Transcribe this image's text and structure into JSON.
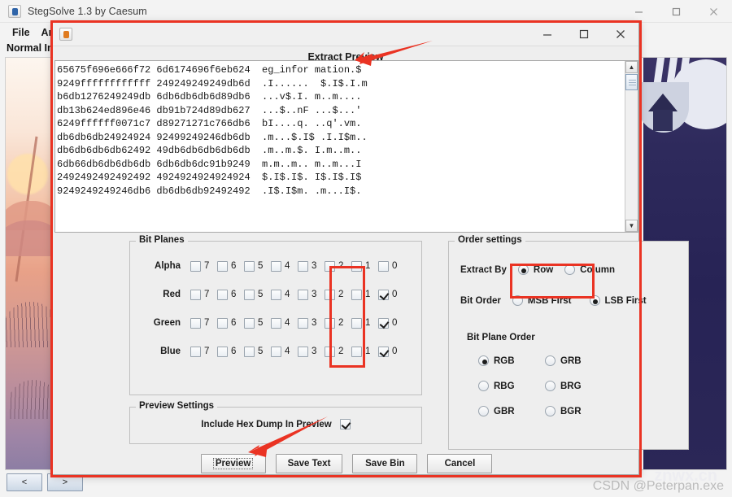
{
  "main_window": {
    "title": "StegSolve 1.3 by Caesum",
    "icon": "java-coffee-cup-icon",
    "menu": [
      "File",
      "Ana"
    ],
    "subtitle": "Normal Im",
    "window_buttons": [
      {
        "name": "minimize",
        "glyph": "─"
      },
      {
        "name": "maximize",
        "glyph": "□"
      },
      {
        "name": "close",
        "glyph": "✕"
      }
    ],
    "nav": [
      {
        "name": "prev",
        "label": "<"
      },
      {
        "name": "next",
        "label": ">"
      }
    ]
  },
  "watermark": {
    "csdn": "CSDN @Peterpan.exe",
    "site": "znwx.cn"
  },
  "dialog": {
    "icon": "java-coffee-cup-icon",
    "heading": "Extract Preview",
    "window_buttons": [
      {
        "name": "minimize",
        "glyph": "─"
      },
      {
        "name": "maximize",
        "glyph": "□"
      },
      {
        "name": "close",
        "glyph": "✕"
      }
    ],
    "hex_dump": [
      {
        "hex1": "65675f696e666f72",
        "hex2": "6d6174696f6eb624",
        "ascii": "eg_infor mation.$"
      },
      {
        "hex1": "9249ffffffffffff",
        "hex2": "249249249249db6d",
        "ascii": ".I......  $.I$.I.m"
      },
      {
        "hex1": "b6db1276249249db",
        "hex2": "6db6db6db6d89db6",
        "ascii": "...v$.I. m..m...."
      },
      {
        "hex1": "db13b624ed896e46",
        "hex2": "db91b724d89db627",
        "ascii": "...$..nF ...$...'"
      },
      {
        "hex1": "6249ffffff0071c7",
        "hex2": "d89271271c766db6",
        "ascii": "bI....q. ..q'.vm."
      },
      {
        "hex1": "db6db6db24924924",
        "hex2": "92499249246db6db",
        "ascii": ".m...$.I$ .I.I$m.."
      },
      {
        "hex1": "db6db6db6db62492",
        "hex2": "49db6db6db6db6db",
        "ascii": ".m..m.$. I.m..m.."
      },
      {
        "hex1": "6db66db6db6db6db",
        "hex2": "6db6db6dc91b9249",
        "ascii": "m.m..m.. m..m...I"
      },
      {
        "hex1": "2492492492492492",
        "hex2": "4924924924924924",
        "ascii": "$.I$.I$. I$.I$.I$"
      },
      {
        "hex1": "9249249249246db6",
        "hex2": "db6db6db92492492",
        "ascii": ".I$.I$m. .m...I$."
      }
    ],
    "bit_planes": {
      "legend": "Bit Planes",
      "bits": [
        "7",
        "6",
        "5",
        "4",
        "3",
        "2",
        "1",
        "0"
      ],
      "rows": [
        {
          "label": "Alpha",
          "checked": [
            false,
            false,
            false,
            false,
            false,
            false,
            false,
            false
          ]
        },
        {
          "label": "Red",
          "checked": [
            false,
            false,
            false,
            false,
            false,
            false,
            false,
            true
          ]
        },
        {
          "label": "Green",
          "checked": [
            false,
            false,
            false,
            false,
            false,
            false,
            false,
            true
          ]
        },
        {
          "label": "Blue",
          "checked": [
            false,
            false,
            false,
            false,
            false,
            false,
            false,
            true
          ]
        }
      ]
    },
    "order_settings": {
      "legend": "Order settings",
      "extract_by": {
        "label": "Extract By",
        "options": [
          {
            "label": "Row",
            "selected": true
          },
          {
            "label": "Column",
            "selected": false
          }
        ]
      },
      "bit_order": {
        "label": "Bit Order",
        "options": [
          {
            "label": "MSB First",
            "selected": false
          },
          {
            "label": "LSB First",
            "selected": true
          }
        ]
      },
      "bit_plane_order": {
        "label": "Bit Plane Order",
        "options": [
          {
            "label": "RGB",
            "selected": true
          },
          {
            "label": "GRB",
            "selected": false
          },
          {
            "label": "RBG",
            "selected": false
          },
          {
            "label": "BRG",
            "selected": false
          },
          {
            "label": "GBR",
            "selected": false
          },
          {
            "label": "BGR",
            "selected": false
          }
        ]
      }
    },
    "preview_settings": {
      "legend": "Preview Settings",
      "include_hex_dump": {
        "label": "Include Hex Dump In Preview",
        "checked": true
      }
    },
    "buttons": [
      {
        "name": "preview",
        "label": "Preview",
        "focused": true
      },
      {
        "name": "save-text",
        "label": "Save Text",
        "focused": false
      },
      {
        "name": "save-bin",
        "label": "Save Bin",
        "focused": false
      },
      {
        "name": "cancel",
        "label": "Cancel",
        "focused": false
      }
    ]
  },
  "annotations": {
    "highlight_color": "#ea3323",
    "rects": [
      "dialog-outline",
      "bit-plane-zero-column",
      "lsb-first-option"
    ],
    "arrows": [
      "arrow-to-hex-ascii",
      "arrow-to-preview-button"
    ]
  }
}
